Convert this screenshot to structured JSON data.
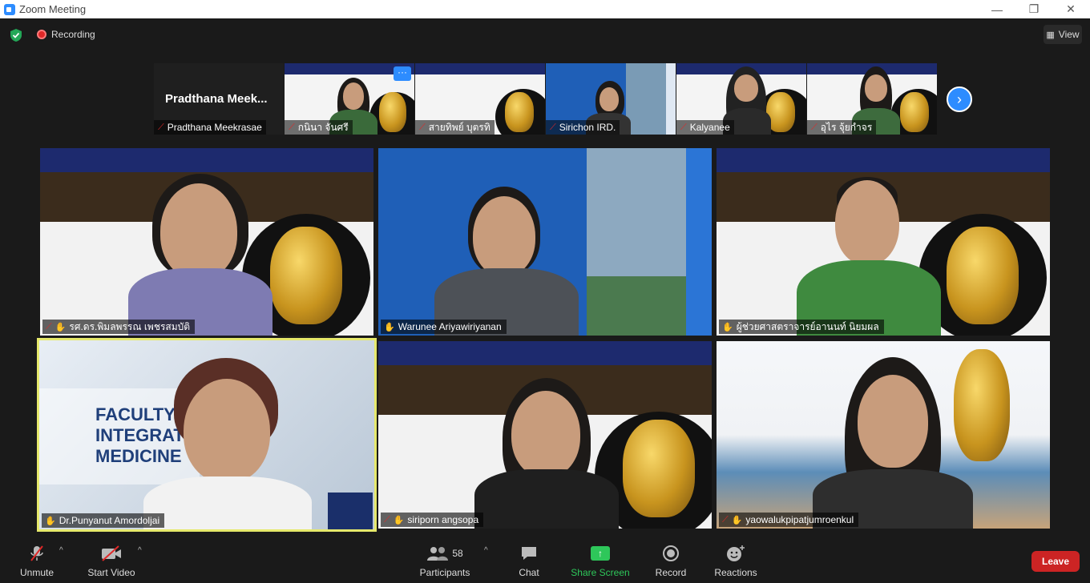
{
  "window": {
    "title": "Zoom Meeting",
    "minimize": "—",
    "restore": "❐",
    "close": "✕"
  },
  "topbar": {
    "recording_label": "Recording",
    "view_label": "View"
  },
  "thumbnails": [
    {
      "name": "Pradthana Meekrasae",
      "big_name": "Pradthana  Meek..."
    },
    {
      "name": "กนินา  จันศรี"
    },
    {
      "name": "สายทิพย์  บุตรทิ"
    },
    {
      "name": "Sirichon IRD."
    },
    {
      "name": "Kalyanee"
    },
    {
      "name": "อุไร จุ้ยกำจร"
    }
  ],
  "tiles": [
    {
      "name": "รศ.ดร.พิมลพรรณ เพชรสมบัติ"
    },
    {
      "name": "Warunee Ariyawiriyanan"
    },
    {
      "name": "ผู้ช่วยศาสตราจารย์อานนท์ นิยมผล"
    },
    {
      "name": "Dr.Punyanut Amordoljai"
    },
    {
      "name": "siriporn angsopa"
    },
    {
      "name": "yaowalukpipatjumroenkul"
    }
  ],
  "toolbar": {
    "unmute": "Unmute",
    "start_video": "Start Video",
    "participants": "Participants",
    "participants_count": "58",
    "chat": "Chat",
    "share_screen": "Share Screen",
    "record": "Record",
    "reactions": "Reactions",
    "leave": "Leave"
  },
  "colors": {
    "accent": "#2D8CFF",
    "leave": "#cc2424",
    "share": "#2ec75a",
    "active_speaker": "#e6e96b"
  }
}
